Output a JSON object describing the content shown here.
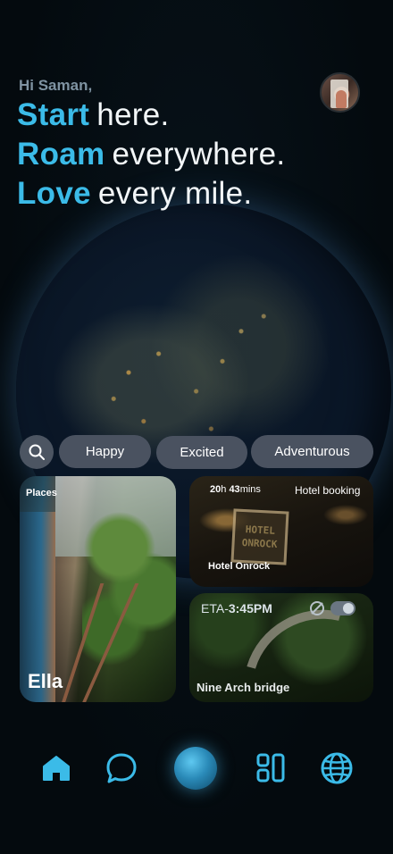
{
  "header": {
    "greeting": "Hi Saman,",
    "lines": [
      {
        "accent": "Start",
        "rest": "here."
      },
      {
        "accent": "Roam",
        "rest": "everywhere."
      },
      {
        "accent": "Love",
        "rest": "every mile."
      }
    ]
  },
  "moods": [
    "Happy",
    "Excited",
    "Adventurous"
  ],
  "cards": {
    "ella": {
      "category": "Places",
      "title": "Ella"
    },
    "hotel": {
      "duration_hours": "20",
      "duration_h_unit": "h",
      "duration_minutes": "43",
      "duration_m_unit": "mins",
      "tag": "Hotel booking",
      "sign_line1": "HOTEL",
      "sign_line2": "ONROCK",
      "title": "Hotel Onrock"
    },
    "bridge": {
      "eta_label": "ETA-",
      "eta_time": "3:45PM",
      "title": "Nine Arch bridge"
    }
  },
  "colors": {
    "accent": "#3bbbe8",
    "chip_bg": "#4a5260",
    "background": "#050b0f"
  },
  "icons": [
    "search-icon",
    "no-sign-icon",
    "home-icon",
    "chat-icon",
    "apps-icon",
    "globe-icon"
  ]
}
